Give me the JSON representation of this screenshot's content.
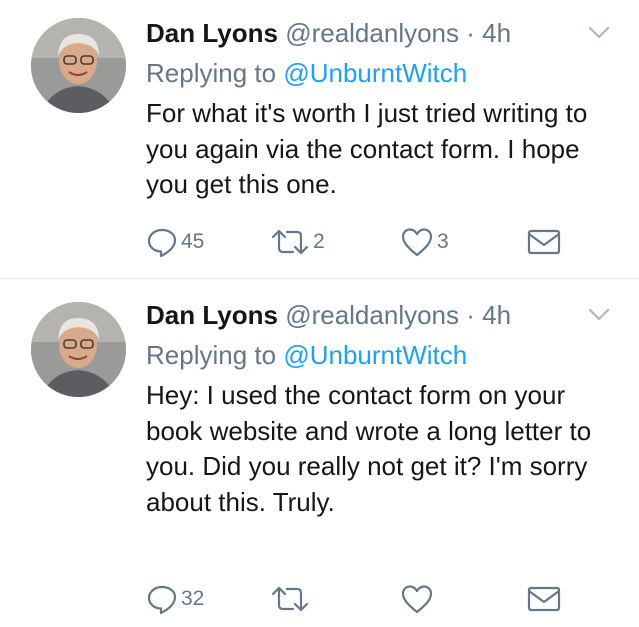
{
  "tweets": [
    {
      "name": "Dan Lyons",
      "handle": "@realdanlyons",
      "time": "4h",
      "separator": "·",
      "replying_prefix": "Replying to",
      "replying_handle": "@UnburntWitch",
      "text": "For what it's worth I just tried writing to you again via the contact form. I hope you get this one.",
      "replies": "45",
      "retweets": "2",
      "likes": "3",
      "icons": [
        "caret-down-icon",
        "reply-icon",
        "retweet-icon",
        "heart-icon",
        "envelope-icon"
      ]
    },
    {
      "name": "Dan Lyons",
      "handle": "@realdanlyons",
      "time": "4h",
      "separator": "·",
      "replying_prefix": "Replying to",
      "replying_handle": "@UnburntWitch",
      "text": "Hey: I used the contact form on your book website and wrote a long letter to you. Did you really not get it? I'm sorry about this. Truly.",
      "replies": "32",
      "retweets": "",
      "likes": "",
      "icons": [
        "caret-down-icon",
        "reply-icon",
        "retweet-icon",
        "heart-icon",
        "envelope-icon"
      ]
    }
  ],
  "colors": {
    "text": "#14171a",
    "secondary": "#657786",
    "link": "#1da1f2",
    "divider": "#e1e8ed"
  }
}
